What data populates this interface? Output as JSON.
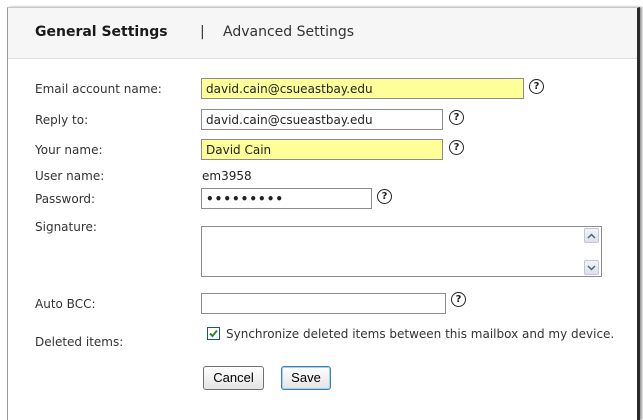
{
  "tabs": {
    "general": "General Settings",
    "separator": "|",
    "advanced": "Advanced Settings"
  },
  "form": {
    "email_account": {
      "label": "Email account name:",
      "value": "david.cain@csueastbay.edu",
      "help": "?"
    },
    "reply_to": {
      "label": "Reply to:",
      "value": "david.cain@csueastbay.edu",
      "help": "?"
    },
    "your_name": {
      "label": "Your name:",
      "value": "David Cain",
      "help": "?"
    },
    "user_name": {
      "label": "User name:",
      "value": "em3958"
    },
    "password": {
      "label": "Password:",
      "value": "•••••••••",
      "help": "?"
    },
    "signature": {
      "label": "Signature:",
      "value": ""
    },
    "auto_bcc": {
      "label": "Auto BCC:",
      "value": "",
      "help": "?"
    },
    "deleted_items": {
      "label": "Deleted items:",
      "checked": true,
      "text": "Synchronize deleted items between this mailbox and my device."
    }
  },
  "buttons": {
    "cancel": "Cancel",
    "save": "Save"
  },
  "icons": {
    "help": "help-icon",
    "scroll_up": "scroll-up-icon",
    "scroll_down": "scroll-down-icon",
    "checkmark": "checkmark-icon"
  },
  "colors": {
    "highlight_field": "#ffff99",
    "checkmark": "#2e8b22",
    "tab_bar": "#f6f6f6"
  }
}
